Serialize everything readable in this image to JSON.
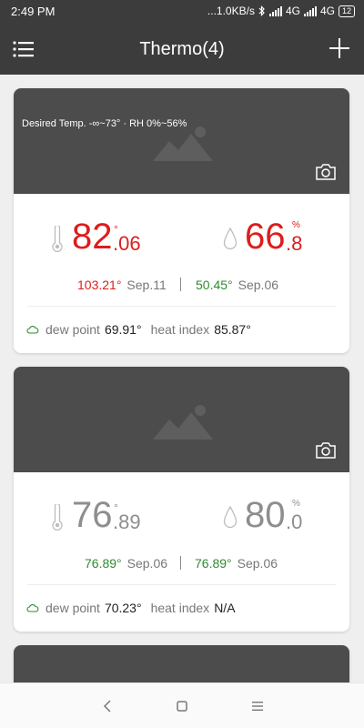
{
  "status": {
    "time": "2:49 PM",
    "speed": "...1.0KB/s",
    "net1": "4G",
    "net2": "4G",
    "battery": "12"
  },
  "header": {
    "title": "Thermo(4)"
  },
  "colors": {
    "hot": "#dd1d1d",
    "normal": "#8e8e8e",
    "green": "#2e8b2e"
  },
  "cards": [
    {
      "desired": "Desired Temp.  -∞~73° · RH  0%~56%",
      "temp": {
        "whole": "82",
        "deg": "°",
        "frac": ".06"
      },
      "humidity": {
        "whole": "66",
        "pct": "%",
        "frac": ".8"
      },
      "high": {
        "value": "103.21°",
        "date": "Sep.11"
      },
      "low": {
        "value": "50.45°",
        "date": "Sep.06"
      },
      "dew_label": "dew point",
      "dew_value": "69.91°",
      "heat_label": "heat index",
      "heat_value": "85.87°"
    },
    {
      "desired": "",
      "temp": {
        "whole": "76",
        "deg": "°",
        "frac": ".89"
      },
      "humidity": {
        "whole": "80",
        "pct": "%",
        "frac": ".0"
      },
      "high": {
        "value": "76.89°",
        "date": "Sep.06"
      },
      "low": {
        "value": "76.89°",
        "date": "Sep.06"
      },
      "dew_label": "dew point",
      "dew_value": "70.23°",
      "heat_label": "heat index",
      "heat_value": "N/A"
    }
  ],
  "icons": [
    "menu-icon",
    "add-icon",
    "image-placeholder-icon",
    "camera-icon",
    "thermometer-icon",
    "droplet-icon",
    "cloud-icon",
    "back-icon",
    "home-icon",
    "recents-icon"
  ]
}
